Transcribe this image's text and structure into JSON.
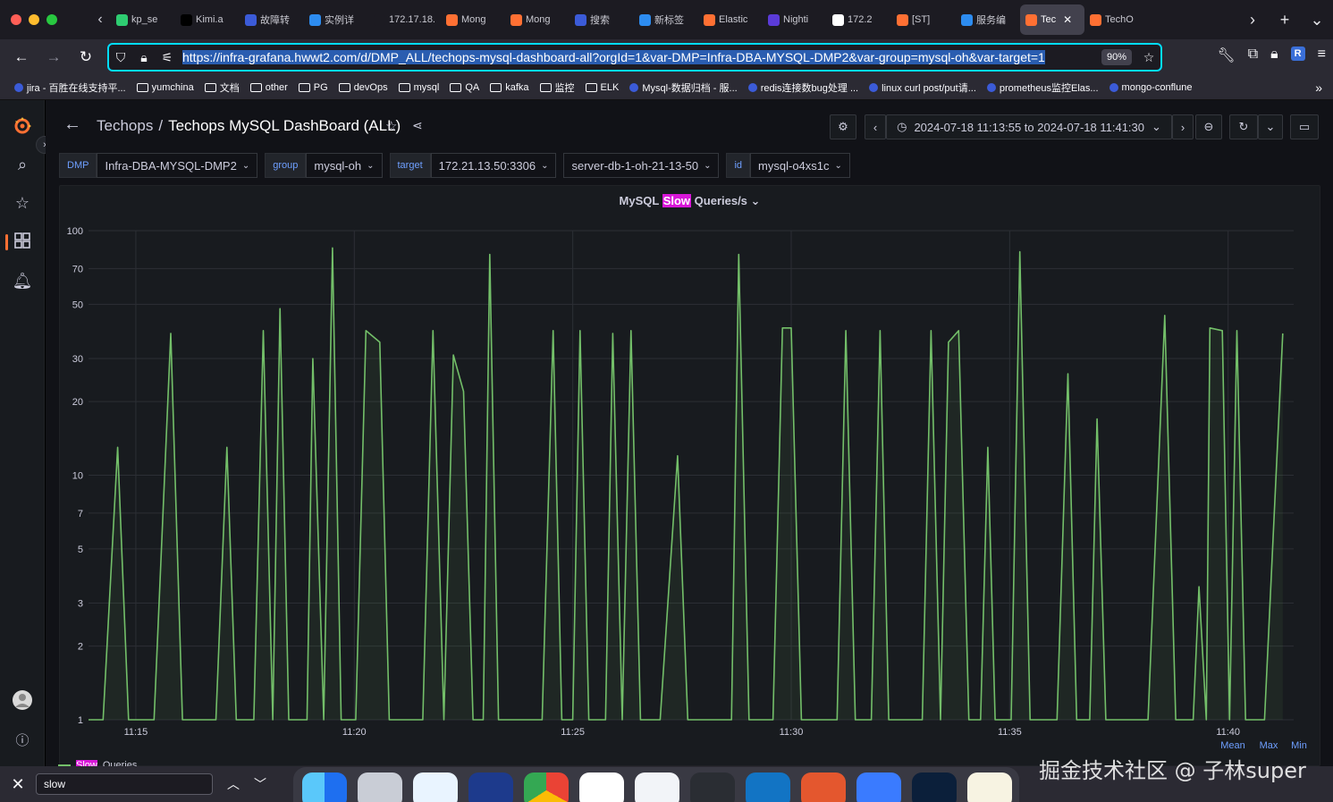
{
  "browser": {
    "tabs": [
      {
        "label": "kp_se",
        "icon_color": "#2ecc71"
      },
      {
        "label": "Kimi.a",
        "icon_color": "#000000"
      },
      {
        "label": "故障转",
        "icon_color": "#3b5bd8"
      },
      {
        "label": "实例详",
        "icon_color": "#2d8cf0"
      },
      {
        "label": "172.17.18.",
        "icon_color": "#1c1b22"
      },
      {
        "label": "Mong",
        "icon_color": "#ff7033"
      },
      {
        "label": "Mong",
        "icon_color": "#ff7033"
      },
      {
        "label": "搜索",
        "icon_color": "#3b5bd8"
      },
      {
        "label": "新标签",
        "icon_color": "#2d8cf0"
      },
      {
        "label": "Elastic",
        "icon_color": "#ff7033"
      },
      {
        "label": "Nighti",
        "icon_color": "#5b3bd8"
      },
      {
        "label": "172.2",
        "icon_color": "#ffffff"
      },
      {
        "label": "[ST]",
        "icon_color": "#ff7033"
      },
      {
        "label": "服务编",
        "icon_color": "#2d8cf0"
      },
      {
        "label": "Tec",
        "icon_color": "#ff7033",
        "active": true
      },
      {
        "label": "TechO",
        "icon_color": "#ff7033"
      }
    ],
    "url": "https://infra-grafana.hwwt2.com/d/DMP_ALL/techops-mysql-dashboard-all?orgId=1&var-DMP=Infra-DBA-MYSQL-DMP2&var-group=mysql-oh&var-target=1",
    "zoom": "90%",
    "bookmarks": [
      {
        "label": "jira - 百胜在线支持平...",
        "type": "dot"
      },
      {
        "label": "yumchina",
        "type": "folder"
      },
      {
        "label": "文档",
        "type": "folder"
      },
      {
        "label": "other",
        "type": "folder"
      },
      {
        "label": "PG",
        "type": "folder"
      },
      {
        "label": "devOps",
        "type": "folder"
      },
      {
        "label": "mysql",
        "type": "folder"
      },
      {
        "label": "QA",
        "type": "folder"
      },
      {
        "label": "kafka",
        "type": "folder"
      },
      {
        "label": "监控",
        "type": "folder"
      },
      {
        "label": "ELK",
        "type": "folder"
      },
      {
        "label": "Mysql-数据归档 - 服...",
        "type": "dot"
      },
      {
        "label": "redis连接数bug处理 ...",
        "type": "dot"
      },
      {
        "label": "linux curl post/put请...",
        "type": "dot"
      },
      {
        "label": "prometheus监控Elas...",
        "type": "dot"
      },
      {
        "label": "mongo-conflune",
        "type": "dot"
      }
    ],
    "find": {
      "value": "slow"
    }
  },
  "dashboard": {
    "breadcrumb": {
      "folder": "Techops",
      "sep": "/",
      "title": "Techops MySQL DashBoard (ALL)"
    },
    "time_range": "2024-07-18 11:13:55 to 2024-07-18 11:41:30",
    "variables": [
      {
        "label": "DMP",
        "value": "Infra-DBA-MYSQL-DMP2"
      },
      {
        "label": "group",
        "value": "mysql-oh"
      },
      {
        "label": "target",
        "value": "172.21.13.50:3306"
      },
      {
        "label": "",
        "value": "server-db-1-oh-21-13-50"
      },
      {
        "label": "id",
        "value": "mysql-o4xs1c"
      }
    ],
    "panel": {
      "title_before": "MySQL ",
      "title_highlight": "Slow",
      "title_after": " Queries/s",
      "legend_highlight": "Slow",
      "legend_rest": " Queries",
      "legend_headers": [
        "Mean",
        "Max",
        "Min"
      ]
    }
  },
  "watermark": "掘金技术社区 @ 子林super",
  "colors": {
    "series": "#73bf69",
    "accent": "#ff7033",
    "link": "#6e9fff",
    "highlight": "#d817d8"
  },
  "chart_data": {
    "type": "line",
    "title": "MySQL Slow Queries/s",
    "xlabel": "",
    "ylabel": "",
    "yscale": "log",
    "ylim": [
      1,
      100
    ],
    "yticks": [
      1,
      2,
      3,
      5,
      7,
      10,
      20,
      30,
      50,
      70,
      100
    ],
    "xticks": [
      "11:15",
      "11:20",
      "11:25",
      "11:30",
      "11:35",
      "11:40"
    ],
    "xlim_minutes": [
      "11:13:55",
      "11:41:30"
    ],
    "grid": true,
    "legend": "bottom",
    "series": [
      {
        "name": "Slow Queries",
        "points": [
          [
            "11:13:55",
            1
          ],
          [
            "11:14:15",
            1
          ],
          [
            "11:14:35",
            13
          ],
          [
            "11:14:50",
            1
          ],
          [
            "11:15:25",
            1
          ],
          [
            "11:15:48",
            38
          ],
          [
            "11:16:04",
            1
          ],
          [
            "11:16:50",
            1
          ],
          [
            "11:17:05",
            13
          ],
          [
            "11:17:18",
            1
          ],
          [
            "11:17:42",
            1
          ],
          [
            "11:17:55",
            39
          ],
          [
            "11:18:08",
            1
          ],
          [
            "11:18:18",
            48
          ],
          [
            "11:18:30",
            1
          ],
          [
            "11:18:55",
            1
          ],
          [
            "11:19:03",
            30
          ],
          [
            "11:19:18",
            1
          ],
          [
            "11:19:30",
            85
          ],
          [
            "11:19:42",
            1
          ],
          [
            "11:20:02",
            1
          ],
          [
            "11:20:16",
            39
          ],
          [
            "11:20:35",
            35
          ],
          [
            "11:20:48",
            1
          ],
          [
            "11:21:34",
            1
          ],
          [
            "11:21:48",
            39
          ],
          [
            "11:22:03",
            1
          ],
          [
            "11:22:16",
            31
          ],
          [
            "11:22:30",
            22
          ],
          [
            "11:22:43",
            1
          ],
          [
            "11:22:57",
            1
          ],
          [
            "11:23:06",
            80
          ],
          [
            "11:23:18",
            1
          ],
          [
            "11:24:18",
            1
          ],
          [
            "11:24:33",
            39
          ],
          [
            "11:24:45",
            1
          ],
          [
            "11:25:00",
            1
          ],
          [
            "11:25:10",
            39
          ],
          [
            "11:25:22",
            1
          ],
          [
            "11:25:45",
            1
          ],
          [
            "11:25:55",
            38
          ],
          [
            "11:26:08",
            1
          ],
          [
            "11:26:20",
            39
          ],
          [
            "11:26:33",
            1
          ],
          [
            "11:27:00",
            1
          ],
          [
            "11:27:24",
            12
          ],
          [
            "11:27:38",
            1
          ],
          [
            "11:28:38",
            1
          ],
          [
            "11:28:48",
            80
          ],
          [
            "11:29:02",
            1
          ],
          [
            "11:29:35",
            1
          ],
          [
            "11:29:48",
            40
          ],
          [
            "11:30:00",
            40
          ],
          [
            "11:30:14",
            1
          ],
          [
            "11:31:03",
            1
          ],
          [
            "11:31:15",
            39
          ],
          [
            "11:31:28",
            1
          ],
          [
            "11:31:50",
            1
          ],
          [
            "11:32:02",
            39
          ],
          [
            "11:32:14",
            1
          ],
          [
            "11:33:00",
            1
          ],
          [
            "11:33:12",
            39
          ],
          [
            "11:33:25",
            1
          ],
          [
            "11:33:36",
            35
          ],
          [
            "11:33:50",
            39
          ],
          [
            "11:34:04",
            1
          ],
          [
            "11:34:20",
            1
          ],
          [
            "11:34:30",
            13
          ],
          [
            "11:34:40",
            1
          ],
          [
            "11:35:02",
            1
          ],
          [
            "11:35:14",
            82
          ],
          [
            "11:35:28",
            1
          ],
          [
            "11:36:05",
            1
          ],
          [
            "11:36:20",
            26
          ],
          [
            "11:36:32",
            1
          ],
          [
            "11:36:50",
            1
          ],
          [
            "11:37:00",
            17
          ],
          [
            "11:37:12",
            1
          ],
          [
            "11:38:10",
            1
          ],
          [
            "11:38:33",
            45
          ],
          [
            "11:38:48",
            1
          ],
          [
            "11:39:12",
            1
          ],
          [
            "11:39:20",
            3.5
          ],
          [
            "11:39:30",
            1
          ],
          [
            "11:39:35",
            40
          ],
          [
            "11:39:52",
            39
          ],
          [
            "11:40:02",
            1
          ],
          [
            "11:40:12",
            39
          ],
          [
            "11:40:24",
            1
          ],
          [
            "11:40:50",
            1
          ],
          [
            "11:41:15",
            38
          ]
        ]
      }
    ]
  }
}
